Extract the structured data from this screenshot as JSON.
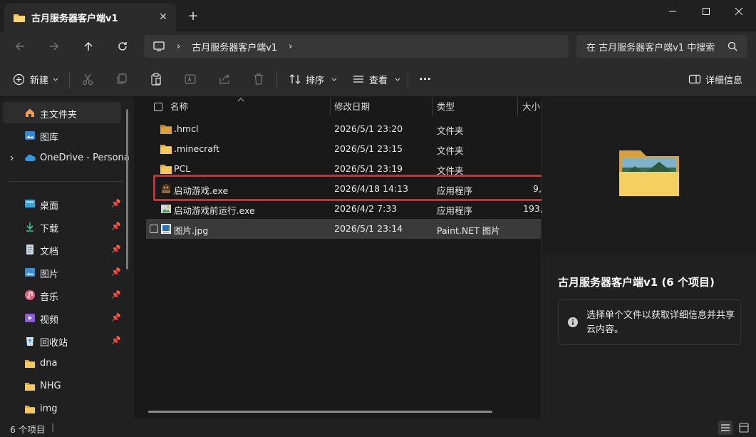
{
  "window": {
    "tab_title": "古月服务器客户端v1",
    "tab_close": "✕",
    "new_tab": "+"
  },
  "addressbar": {
    "crumb_sep": "›",
    "crumb": "古月服务器客户端v1",
    "search_placeholder": "在 古月服务器客户端v1 中搜索"
  },
  "toolbar": {
    "new_label": "新建",
    "sort_label": "排序",
    "view_label": "查看",
    "more_label": "···",
    "details_label": "详细信息"
  },
  "sidebar": {
    "home": "主文件夹",
    "gallery": "图库",
    "onedrive": "OneDrive - Persona",
    "pinned": [
      {
        "label": "桌面",
        "icon": "desktop-icon"
      },
      {
        "label": "下载",
        "icon": "download-icon"
      },
      {
        "label": "文档",
        "icon": "document-icon"
      },
      {
        "label": "图片",
        "icon": "pictures-icon"
      },
      {
        "label": "音乐",
        "icon": "music-icon"
      },
      {
        "label": "视频",
        "icon": "video-icon"
      },
      {
        "label": "回收站",
        "icon": "recycle-bin-icon"
      }
    ],
    "folders": [
      "dna",
      "NHG",
      "img"
    ]
  },
  "filelist": {
    "columns": {
      "name": "名称",
      "modified": "修改日期",
      "type": "类型",
      "size": "大小"
    },
    "rows": [
      {
        "name": ".hmcl",
        "modified": "2026/5/1 23:20",
        "type": "文件夹",
        "size": "",
        "icon": "folder-icon"
      },
      {
        "name": ".minecraft",
        "modified": "2026/5/1 23:15",
        "type": "文件夹",
        "size": "",
        "icon": "folder-icon"
      },
      {
        "name": "PCL",
        "modified": "2026/5/1 23:19",
        "type": "文件夹",
        "size": "",
        "icon": "folder-icon"
      },
      {
        "name": "启动游戏.exe",
        "modified": "2026/4/18 14:13",
        "type": "应用程序",
        "size": "9,",
        "icon": "exe-icon"
      },
      {
        "name": "启动游戏前运行.exe",
        "modified": "2026/4/2 7:33",
        "type": "应用程序",
        "size": "193,",
        "icon": "exe-icon"
      },
      {
        "name": "图片.jpg",
        "modified": "2026/5/1 23:14",
        "type": "Paint.NET 图片",
        "size": "",
        "icon": "image-file-icon"
      }
    ]
  },
  "preview": {
    "title": "古月服务器客户端v1 (6 个项目)",
    "info": "选择单个文件以获取详细信息并共享云内容。"
  },
  "status": {
    "count": "6 个项目",
    "sep": "|"
  },
  "colors": {
    "accent_highlight": "#e0252b",
    "folder": "#f2c14e"
  }
}
